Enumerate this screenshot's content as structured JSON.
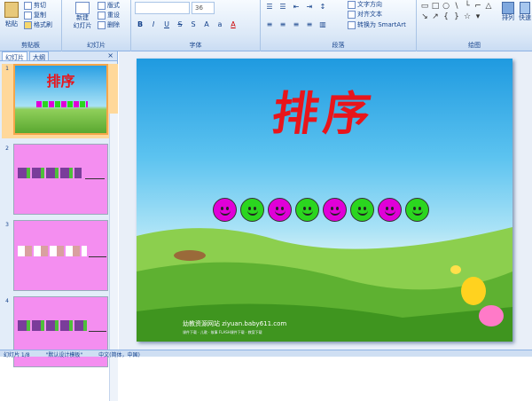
{
  "ribbon": {
    "clipboard": {
      "label": "剪贴板",
      "paste": "粘贴",
      "copy_top": "剪切",
      "copy": "复制",
      "format_painter": "格式刷"
    },
    "slides": {
      "label": "幻灯片",
      "new_slide": "新建",
      "new_slide_2": "幻灯片",
      "layout": "版式",
      "reset": "重设",
      "delete": "删除"
    },
    "font": {
      "label": "字体",
      "font_size": "36",
      "font_name": ""
    },
    "paragraph": {
      "label": "段落",
      "text_direction": "文字方向",
      "align_text": "对齐文本",
      "smartart": "转换为 SmartArt"
    },
    "drawing": {
      "label": "绘图",
      "arrange": "排列",
      "quick_styles": "快速"
    }
  },
  "pane": {
    "tab_slides": "幻灯片",
    "tab_outline": "大纲",
    "close": "×",
    "slides": [
      {
        "num": "1"
      },
      {
        "num": "2"
      },
      {
        "num": "3"
      },
      {
        "num": "4"
      }
    ]
  },
  "slide": {
    "title": "排序",
    "smileys": [
      {
        "color": "#e000d8"
      },
      {
        "color": "#2bd61f"
      },
      {
        "color": "#e000d8"
      },
      {
        "color": "#2bd61f"
      },
      {
        "color": "#e000d8"
      },
      {
        "color": "#2bd61f"
      },
      {
        "color": "#e000d8"
      },
      {
        "color": "#2bd61f"
      }
    ],
    "credit": "幼教资源网站 ziyuan.baby611.com",
    "credit_small": "课件下载 · 儿歌 · 故事  FLASH课件下载 · 教案下载"
  },
  "thumb1_title": "排序",
  "status": {
    "slide_info": "幻灯片 1/8",
    "theme": "\"默认设计模板\"",
    "language": "中文(简体，中国)"
  }
}
